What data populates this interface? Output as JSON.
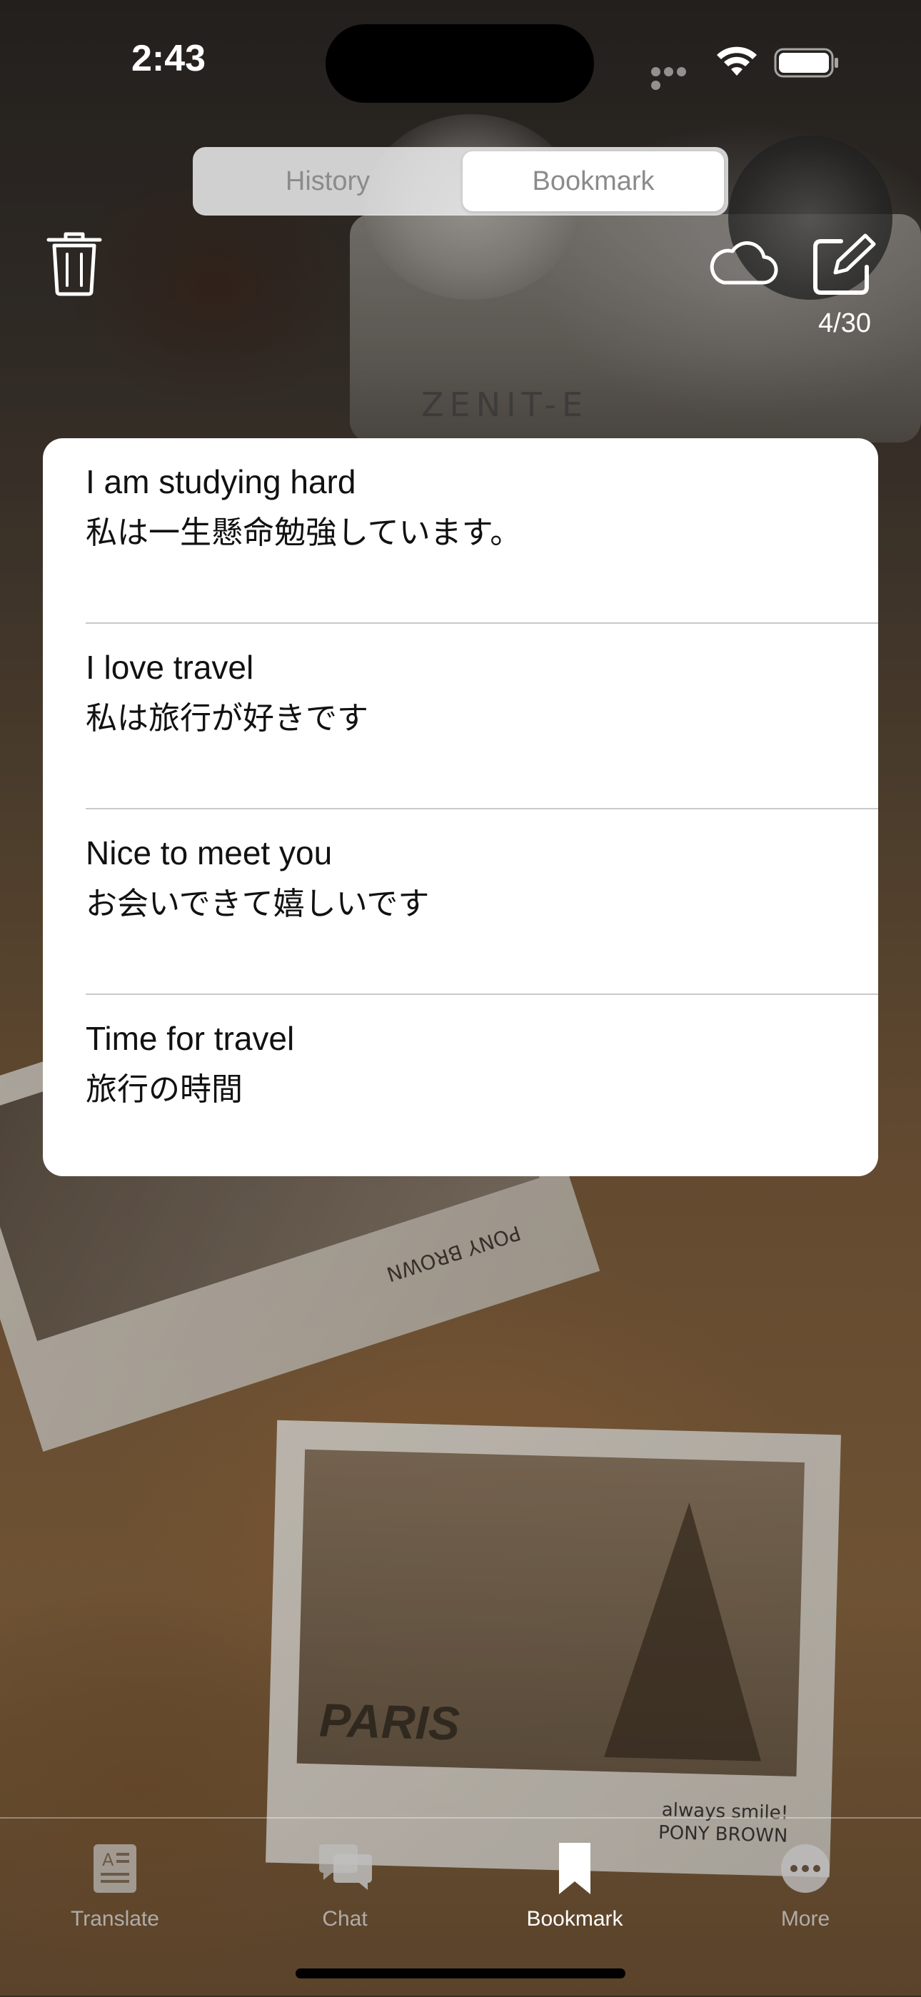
{
  "status_bar": {
    "time": "2:43"
  },
  "segmented_control": {
    "options": [
      "History",
      "Bookmark"
    ],
    "selected": "Bookmark"
  },
  "toolbar": {
    "left_icon": "trash-icon",
    "right_icons": [
      "cloud-icon",
      "compose-icon"
    ],
    "count": "4/30"
  },
  "bookmarks": [
    {
      "en": "I am studying hard",
      "ja": "私は一生懸命勉強しています。"
    },
    {
      "en": "I love travel",
      "ja": "私は旅行が好きです"
    },
    {
      "en": "Nice to meet you",
      "ja": "お会いできて嬉しいです"
    },
    {
      "en": "Time for travel",
      "ja": "旅行の時間"
    }
  ],
  "background": {
    "camera_mark": "ZENIT-E",
    "photo_word": "PARIS",
    "photo_signature_line1": "always smile!",
    "photo_signature_line2": "PONY BROWN",
    "photo1_caption_line1": "PONY BROWN"
  },
  "tab_bar": {
    "items": [
      {
        "label": "Translate",
        "icon": "translate-icon"
      },
      {
        "label": "Chat",
        "icon": "chat-bubbles-icon"
      },
      {
        "label": "Bookmark",
        "icon": "bookmark-icon"
      },
      {
        "label": "More",
        "icon": "more-icon"
      }
    ],
    "selected": "Bookmark"
  },
  "colors": {
    "active_tab": "#ffffff",
    "inactive_tab": "#bebebe",
    "card_background": "#ffffff"
  }
}
